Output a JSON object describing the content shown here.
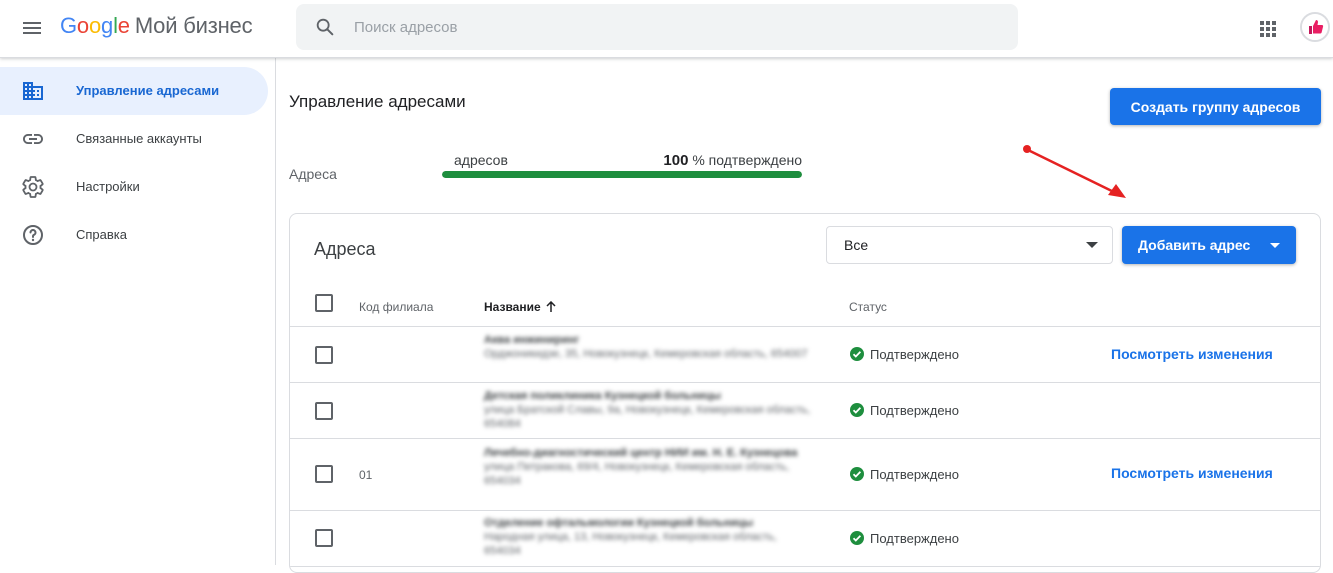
{
  "header": {
    "logo_letters": [
      "G",
      "o",
      "o",
      "g",
      "l",
      "e"
    ],
    "product": "Мой бизнес",
    "search_placeholder": "Поиск адресов",
    "menu_icon": "hamburger-menu-icon",
    "apps_icon": "apps-grid-icon",
    "avatar_icon": "thumbs-up-avatar"
  },
  "sidebar": {
    "items": [
      {
        "label": "Управление адресами",
        "icon": "building-icon",
        "active": true
      },
      {
        "label": "Связанные аккаунты",
        "icon": "link-icon",
        "active": false
      },
      {
        "label": "Настройки",
        "icon": "gear-icon",
        "active": false
      },
      {
        "label": "Справка",
        "icon": "help-icon",
        "active": false
      }
    ]
  },
  "main": {
    "title": "Управление адресами",
    "create_group_label": "Создать группу адресов",
    "addresses_label": "Адреса",
    "progress": {
      "count_label": "адресов",
      "percent": "100",
      "percent_suffix": "% подтверждено",
      "fraction": 1.0,
      "color": "#1e8e3e"
    }
  },
  "card": {
    "title": "Адреса",
    "filter_value": "Все",
    "add_button_label": "Добавить адрес",
    "columns": {
      "code": "Код филиала",
      "name": "Название",
      "status": "Статус"
    },
    "rows": [
      {
        "code": "",
        "name_line1": "Аква инжиниринг",
        "name_line2": "Орджоникидзе, 35, Новокузнецк, Кемеровская область, 654007",
        "status": "Подтверждено",
        "link": "Посмотреть изменения"
      },
      {
        "code": "",
        "name_line1": "Детская поликлиника Кузнецкой больницы",
        "name_line2": "улица Братской Славы, 9а, Новокузнецк, Кемеровская область, 654084",
        "status": "Подтверждено",
        "link": ""
      },
      {
        "code": "01",
        "name_line1": "Лечебно-диагностический центр НИИ им. Н. Е. Кузнецова",
        "name_line2": "улица Петракова, 69/4, Новокузнецк, Кемеровская область, 654034",
        "status": "Подтверждено",
        "link": "Посмотреть изменения"
      },
      {
        "code": "",
        "name_line1": "Отделение офтальмологии Кузнецкой больницы",
        "name_line2": "Народная улица, 13, Новокузнецк, Кемеровская область, 654034",
        "status": "Подтверждено",
        "link": ""
      }
    ]
  },
  "colors": {
    "primary": "#1a73e8",
    "active_nav_bg": "#e8f0fe",
    "success": "#1e8e3e",
    "annotation_arrow": "#e52222"
  }
}
